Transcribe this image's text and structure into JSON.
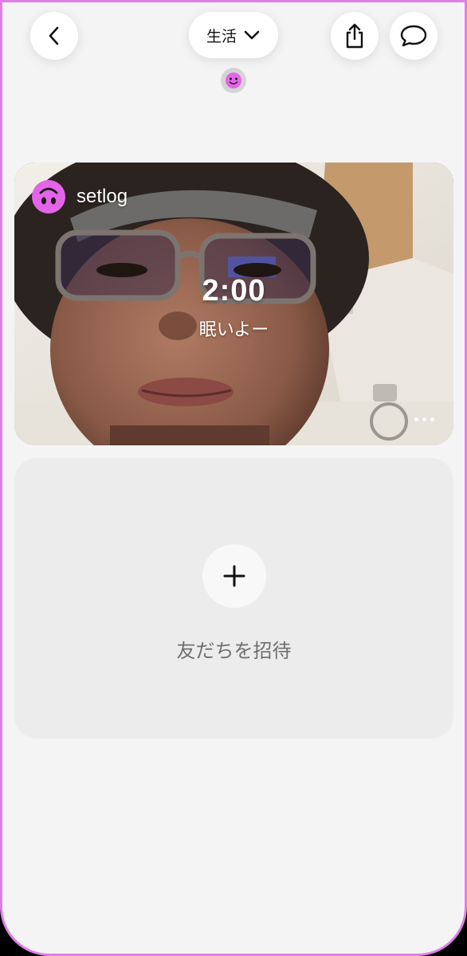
{
  "header": {
    "category_label": "生活"
  },
  "icons": {
    "back": "chevron-left-icon",
    "dropdown": "chevron-down-icon",
    "share": "share-icon",
    "chat": "chat-bubble-icon",
    "mood": "smiley-icon",
    "avatar": "upside-down-smiley-icon",
    "more": "more-dots-icon",
    "add": "plus-icon"
  },
  "post": {
    "username": "setlog",
    "time": "2:00",
    "caption": "眠いよー"
  },
  "invite": {
    "label": "友だちを招待"
  },
  "colors": {
    "accent": "#e365e6",
    "frame_border": "#e07ee8",
    "background": "#f4f4f4"
  }
}
